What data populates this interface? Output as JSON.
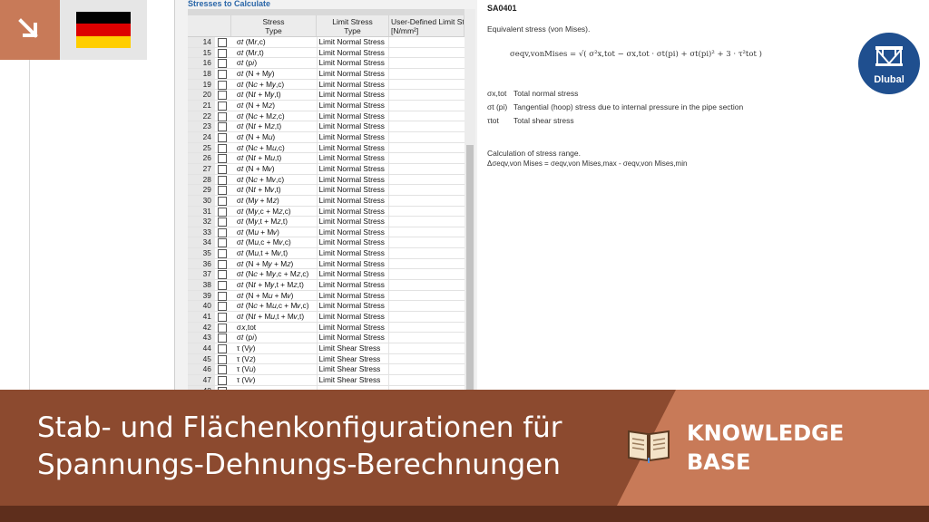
{
  "table": {
    "title": "Stresses to Calculate",
    "headers": {
      "type_1": "Stress",
      "type_2": "Type",
      "limit_1": "Limit Stress",
      "limit_2": "Type",
      "user_1": "User-Defined Limit St",
      "user_2": "[N/mm²]"
    },
    "rows": [
      {
        "num": "14",
        "type": "σ𝑡 (M𝑟,c)",
        "limit": "Limit Normal Stress"
      },
      {
        "num": "15",
        "type": "σ𝑡 (M𝑟,t)",
        "limit": "Limit Normal Stress"
      },
      {
        "num": "16",
        "type": "σ𝑡 (p𝑖)",
        "limit": "Limit Normal Stress"
      },
      {
        "num": "18",
        "type": "σ𝑡 (N + M𝑦)",
        "limit": "Limit Normal Stress"
      },
      {
        "num": "19",
        "type": "σ𝑡 (N𝑐 + M𝑦,c)",
        "limit": "Limit Normal Stress"
      },
      {
        "num": "20",
        "type": "σ𝑡 (N𝑡 + M𝑦,t)",
        "limit": "Limit Normal Stress"
      },
      {
        "num": "21",
        "type": "σ𝑡 (N + M𝑧)",
        "limit": "Limit Normal Stress"
      },
      {
        "num": "22",
        "type": "σ𝑡 (N𝑐 + M𝑧,c)",
        "limit": "Limit Normal Stress"
      },
      {
        "num": "23",
        "type": "σ𝑡 (N𝑡 + M𝑧,t)",
        "limit": "Limit Normal Stress"
      },
      {
        "num": "24",
        "type": "σ𝑡 (N + M𝑢)",
        "limit": "Limit Normal Stress"
      },
      {
        "num": "25",
        "type": "σ𝑡 (N𝑐 + M𝑢,c)",
        "limit": "Limit Normal Stress"
      },
      {
        "num": "26",
        "type": "σ𝑡 (N𝑡 + M𝑢,t)",
        "limit": "Limit Normal Stress"
      },
      {
        "num": "27",
        "type": "σ𝑡 (N + M𝑣)",
        "limit": "Limit Normal Stress"
      },
      {
        "num": "28",
        "type": "σ𝑡 (N𝑐 + M𝑣,c)",
        "limit": "Limit Normal Stress"
      },
      {
        "num": "29",
        "type": "σ𝑡 (N𝑡 + M𝑣,t)",
        "limit": "Limit Normal Stress"
      },
      {
        "num": "30",
        "type": "σ𝑡 (M𝑦 + M𝑧)",
        "limit": "Limit Normal Stress"
      },
      {
        "num": "31",
        "type": "σ𝑡 (M𝑦,c + M𝑧,c)",
        "limit": "Limit Normal Stress"
      },
      {
        "num": "32",
        "type": "σ𝑡 (M𝑦,t + M𝑧,t)",
        "limit": "Limit Normal Stress"
      },
      {
        "num": "33",
        "type": "σ𝑡 (M𝑢 + M𝑣)",
        "limit": "Limit Normal Stress"
      },
      {
        "num": "34",
        "type": "σ𝑡 (M𝑢,c + M𝑣,c)",
        "limit": "Limit Normal Stress"
      },
      {
        "num": "35",
        "type": "σ𝑡 (M𝑢,t + M𝑣,t)",
        "limit": "Limit Normal Stress"
      },
      {
        "num": "36",
        "type": "σ𝑡 (N + M𝑦 + M𝑧)",
        "limit": "Limit Normal Stress"
      },
      {
        "num": "37",
        "type": "σ𝑡 (N𝑐 + M𝑦,c + M𝑧,c)",
        "limit": "Limit Normal Stress"
      },
      {
        "num": "38",
        "type": "σ𝑡 (N𝑡 + M𝑦,t + M𝑧,t)",
        "limit": "Limit Normal Stress"
      },
      {
        "num": "39",
        "type": "σ𝑡 (N + M𝑢 + M𝑣)",
        "limit": "Limit Normal Stress"
      },
      {
        "num": "40",
        "type": "σ𝑡 (N𝑐 + M𝑢,c + M𝑣,c)",
        "limit": "Limit Normal Stress"
      },
      {
        "num": "41",
        "type": "σ𝑡 (N𝑡 + M𝑢,t + M𝑣,t)",
        "limit": "Limit Normal Stress"
      },
      {
        "num": "42",
        "type": "σ𝑥,tot",
        "limit": "Limit Normal Stress"
      },
      {
        "num": "43",
        "type": "σ𝑡 (p𝑖)",
        "limit": "Limit Normal Stress"
      },
      {
        "num": "44",
        "type": "τ (V𝑦)",
        "limit": "Limit Shear Stress"
      },
      {
        "num": "45",
        "type": "τ (V𝑧)",
        "limit": "Limit Shear Stress"
      },
      {
        "num": "46",
        "type": "τ (V𝑢)",
        "limit": "Limit Shear Stress"
      },
      {
        "num": "47",
        "type": "τ (V𝑣)",
        "limit": "Limit Shear Stress"
      },
      {
        "num": "48",
        "type": "",
        "limit": ""
      }
    ]
  },
  "doc": {
    "code": "SA0401",
    "intro": "Equivalent stress (von Mises).",
    "formula": "σeqv,vonMises = √( σ²x,tot − σx,tot · σt(pi) + σt(pi)² + 3 · τ²tot )",
    "legend": [
      {
        "sym": "σx,tot",
        "desc": "Total normal stress"
      },
      {
        "sym": "σt (pi)",
        "desc": "Tangential (hoop) stress due to internal pressure in the pipe section"
      },
      {
        "sym": "τtot",
        "desc": "Total shear stress"
      }
    ],
    "range_title": "Calculation of stress range.",
    "range_formula": "Δσeqv,von Mises = σeqv,von Mises,max - σeqv,von Mises,min"
  },
  "logo": {
    "text": "Dlubal"
  },
  "banner": {
    "line1": "Stab- und Flächenkonfigurationen für",
    "line2": "Spannungs-Dehnungs-Berechnungen",
    "kb_line1": "KNOWLEDGE",
    "kb_line2": "BASE"
  },
  "colors": {
    "banner_dark": "#8c4a2f",
    "banner_light": "#c87a58",
    "logo_blue": "#1f4f8f",
    "title_blue": "#2a66a8"
  },
  "icons": {
    "corner": "arrow-down-right-icon",
    "flag": "germany-flag-icon",
    "book": "open-book-icon"
  }
}
